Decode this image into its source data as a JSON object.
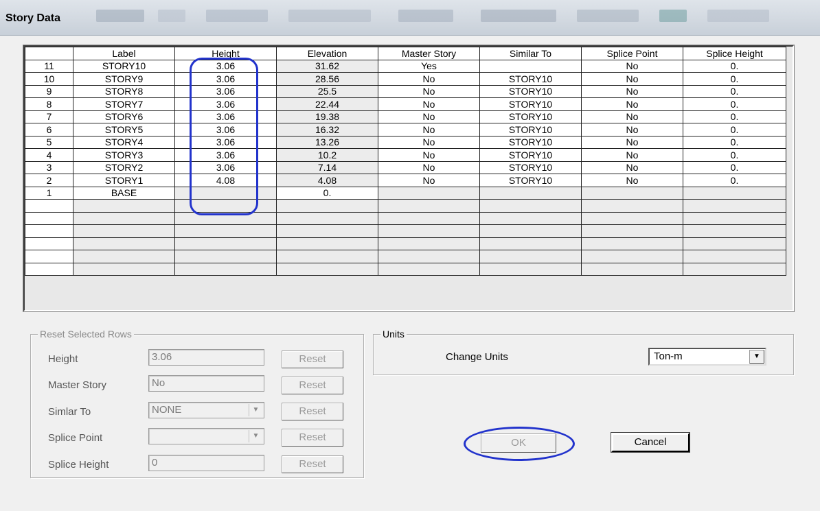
{
  "window": {
    "title": "Story Data"
  },
  "grid": {
    "columns": [
      "Label",
      "Height",
      "Elevation",
      "Master Story",
      "Similar To",
      "Splice Point",
      "Splice Height"
    ],
    "rows": [
      {
        "num": "11",
        "label": "STORY10",
        "height": "3.06",
        "elevation": "31.62",
        "master": "Yes",
        "similar": "",
        "splice_point": "No",
        "splice_height": "0."
      },
      {
        "num": "10",
        "label": "STORY9",
        "height": "3.06",
        "elevation": "28.56",
        "master": "No",
        "similar": "STORY10",
        "splice_point": "No",
        "splice_height": "0."
      },
      {
        "num": "9",
        "label": "STORY8",
        "height": "3.06",
        "elevation": "25.5",
        "master": "No",
        "similar": "STORY10",
        "splice_point": "No",
        "splice_height": "0."
      },
      {
        "num": "8",
        "label": "STORY7",
        "height": "3.06",
        "elevation": "22.44",
        "master": "No",
        "similar": "STORY10",
        "splice_point": "No",
        "splice_height": "0."
      },
      {
        "num": "7",
        "label": "STORY6",
        "height": "3.06",
        "elevation": "19.38",
        "master": "No",
        "similar": "STORY10",
        "splice_point": "No",
        "splice_height": "0."
      },
      {
        "num": "6",
        "label": "STORY5",
        "height": "3.06",
        "elevation": "16.32",
        "master": "No",
        "similar": "STORY10",
        "splice_point": "No",
        "splice_height": "0."
      },
      {
        "num": "5",
        "label": "STORY4",
        "height": "3.06",
        "elevation": "13.26",
        "master": "No",
        "similar": "STORY10",
        "splice_point": "No",
        "splice_height": "0."
      },
      {
        "num": "4",
        "label": "STORY3",
        "height": "3.06",
        "elevation": "10.2",
        "master": "No",
        "similar": "STORY10",
        "splice_point": "No",
        "splice_height": "0."
      },
      {
        "num": "3",
        "label": "STORY2",
        "height": "3.06",
        "elevation": "7.14",
        "master": "No",
        "similar": "STORY10",
        "splice_point": "No",
        "splice_height": "0."
      },
      {
        "num": "2",
        "label": "STORY1",
        "height": "4.08",
        "elevation": "4.08",
        "master": "No",
        "similar": "STORY10",
        "splice_point": "No",
        "splice_height": "0."
      },
      {
        "num": "1",
        "label": "BASE",
        "height": "",
        "elevation": "0.",
        "master": "",
        "similar": "",
        "splice_point": "",
        "splice_height": ""
      }
    ]
  },
  "reset_group": {
    "title": "Reset Selected Rows",
    "height_label": "Height",
    "height_value": "3.06",
    "master_label": "Master Story",
    "master_value": "No",
    "similar_label": "Simlar To",
    "similar_value": "NONE",
    "splice_point_label": "Splice Point",
    "splice_point_value": "",
    "splice_height_label": "Splice Height",
    "splice_height_value": "0",
    "reset_label": "Reset"
  },
  "units_group": {
    "title": "Units",
    "change_label": "Change Units",
    "selected": "Ton-m"
  },
  "buttons": {
    "ok": "OK",
    "cancel": "Cancel"
  },
  "colors": {
    "highlight": "#2233cc"
  }
}
